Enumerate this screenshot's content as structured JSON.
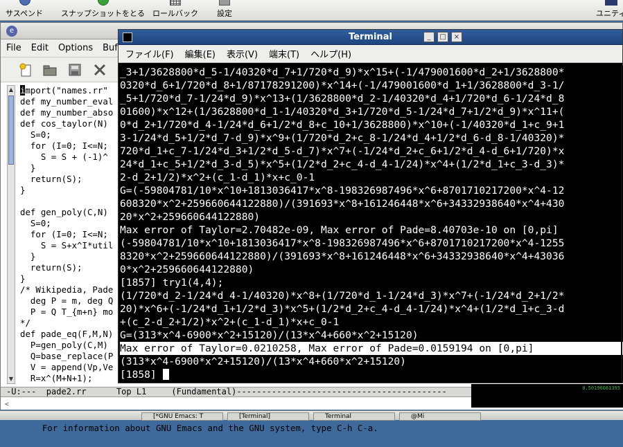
{
  "top_toolbar": {
    "buttons": [
      {
        "label": "サスペンド",
        "icon": "suspend-icon"
      },
      {
        "label": "スナップショットをとる",
        "icon": "snapshot-icon"
      },
      {
        "label": "ロールバック",
        "icon": "rollback-icon"
      },
      {
        "label": "設定",
        "icon": "settings-icon"
      },
      {
        "label": "ユニティ",
        "icon": "unity-icon"
      }
    ]
  },
  "emacs": {
    "menu": [
      "File",
      "Edit",
      "Options",
      "Buf"
    ],
    "toolbar_icons": [
      "new-file-icon",
      "open-folder-icon",
      "save-icon",
      "cut-icon"
    ],
    "code_lines": [
      "import(\"names.rr\"",
      "def my_number_eval",
      "def my_number_abso",
      "def cos_taylor(N)",
      "  S=0;",
      "  for (I=0; I<=N;",
      "    S = S + (-1)^",
      "  }",
      "  return(S);",
      "}",
      "",
      "def gen_poly(C,N)",
      "  S=0;",
      "  for (I=0; I<=N;",
      "    S = S+x^I*util",
      "  }",
      "  return(S);",
      "}",
      "/* Wikipedia, Pade",
      "  deg P = m, deg Q",
      "  P = Q T_{m+n} mo",
      "*/",
      "def pade_eq(F,M,N)",
      "  P=gen_poly(C,M)",
      "  Q=base_replace(P",
      "  V = append(Vp,Ve",
      "  R=x^(M+N+1);"
    ],
    "modeline": "-U:---  pade2.rr      Top L1     (Fundamental)------------------------------------------",
    "echo": "For information about GNU Emacs and the GNU system, type C-h C-a."
  },
  "terminal": {
    "title": "Terminal",
    "menu": [
      "ファイル(F)",
      "編集(E)",
      "表示(V)",
      "端末(T)",
      "ヘルプ(H)"
    ],
    "lines": [
      "_3+1/3628800*d_5-1/40320*d_7+1/720*d_9)*x^15+(-1/479001600*d_2+1/3628800*",
      "0320*d_6+1/720*d_8+1/87178291200)*x^14+(-1/479001600*d_1+1/3628800*d_3-1/",
      "_5+1/720*d_7-1/24*d_9)*x^13+(1/3628800*d_2-1/40320*d_4+1/720*d_6-1/24*d_8",
      "01600)*x^12+(1/3628800*d_1-1/40320*d_3+1/720*d_5-1/24*d_7+1/2*d_9)*x^11+(",
      "0*d_2+1/720*d_4-1/24*d_6+1/2*d_8+c_10+1/3628800)*x^10+(-1/40320*d_1+c_9+1",
      "3-1/24*d_5+1/2*d_7-d_9)*x^9+(1/720*d_2+c_8-1/24*d_4+1/2*d_6-d_8-1/40320)*",
      "720*d_1+c_7-1/24*d_3+1/2*d_5-d_7)*x^7+(-1/24*d_2+c_6+1/2*d_4-d_6+1/720)*x",
      "24*d_1+c_5+1/2*d_3-d_5)*x^5+(1/2*d_2+c_4-d_4-1/24)*x^4+(1/2*d_1+c_3-d_3)*",
      "2-d_2+1/2)*x^2+(c_1-d_1)*x+c_0-1",
      "G=(-59804781/10*x^10+1813036417*x^8-198326987496*x^6+8701710217200*x^4-12",
      "608320*x^2+259660644122880)/(391693*x^8+161246448*x^6+34332938640*x^4+430",
      "20*x^2+259660644122880)",
      "Max error of Taylor=2.70482e-09, Max error of Pade=8.40703e-10 on [0,pi]",
      "(-59804781/10*x^10+1813036417*x^8-198326987496*x^6+8701710217200*x^4-1255",
      "8320*x^2+259660644122880)/(391693*x^8+161246448*x^6+34332938640*x^4+43036",
      "0*x^2+259660644122880)",
      "[1857] try1(4,4);",
      "(1/720*d_2-1/24*d_4-1/40320)*x^8+(1/720*d_1-1/24*d_3)*x^7+(-1/24*d_2+1/2*",
      "20)*x^6+(-1/24*d_1+1/2*d_3)*x^5+(1/2*d_2+c_4-d_4-1/24)*x^4+(1/2*d_1+c_3-d",
      "+(c_2-d_2+1/2)*x^2+(c_1-d_1)*x+c_0-1",
      "G=(313*x^4-6900*x^2+15120)/(13*x^4+660*x^2+15120)",
      "Max error of Taylor=0.0210258, Max error of Pade=0.0159194 on [0,pi]",
      "(313*x^4-6900*x^2+15120)/(13*x^4+660*x^2+15120)",
      "[1858] "
    ]
  },
  "background_readout": "0.50196081395",
  "taskbar": {
    "tasks": [
      "[*GNU Emacs: T",
      "[Terminal]",
      "Terminal",
      "@Mi"
    ]
  }
}
